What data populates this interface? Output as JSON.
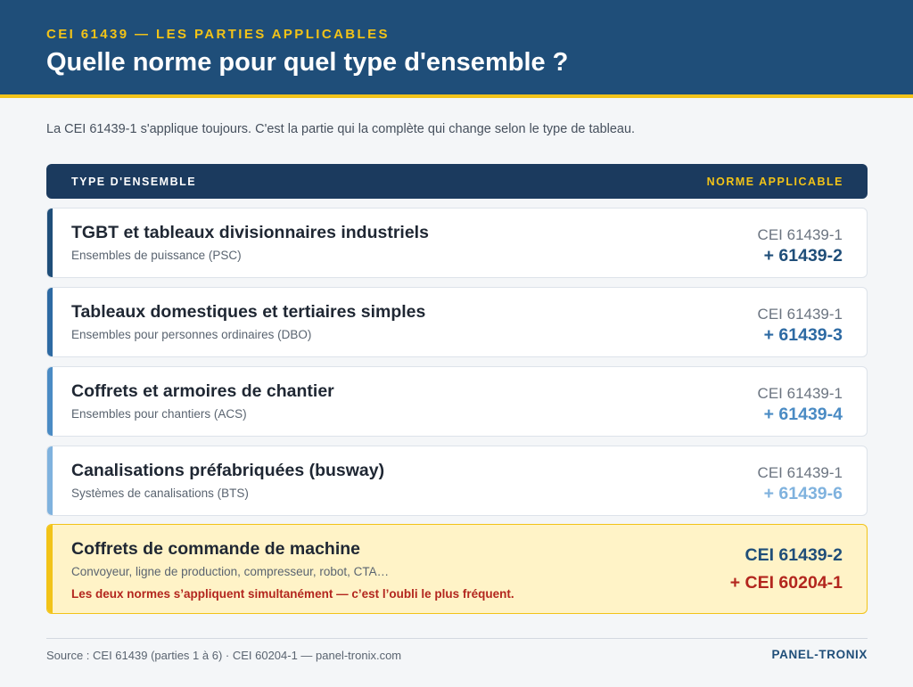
{
  "header": {
    "kicker": "CEI 61439 — LES PARTIES APPLICABLES",
    "title": "Quelle norme pour quel type d'ensemble ?"
  },
  "intro": "La CEI 61439-1 s'applique toujours. C'est la partie qui la complète qui change selon le type de tableau.",
  "table": {
    "col_left": "TYPE D'ENSEMBLE",
    "col_right": "NORME APPLICABLE",
    "rows": [
      {
        "name": "TGBT et tableaux divisionnaires industriels",
        "sub": "Ensembles de puissance (PSC)",
        "base": "CEI 61439-1",
        "plus": "+ 61439-2",
        "accent": "#1f4e79"
      },
      {
        "name": "Tableaux domestiques et tertiaires simples",
        "sub": "Ensembles pour personnes ordinaires (DBO)",
        "base": "CEI 61439-1",
        "plus": "+ 61439-3",
        "accent": "#2d6aa3"
      },
      {
        "name": "Coffrets et armoires de chantier",
        "sub": "Ensembles pour chantiers (ACS)",
        "base": "CEI 61439-1",
        "plus": "+ 61439-4",
        "accent": "#4a8bc4"
      },
      {
        "name": "Canalisations préfabriquées (busway)",
        "sub": "Systèmes de canalisations (BTS)",
        "base": "CEI 61439-1",
        "plus": "+ 61439-6",
        "accent": "#7fb2de"
      }
    ],
    "special": {
      "name": "Coffrets de commande de machine",
      "sub": "Convoyeur, ligne de production, compresseur, robot, CTA…",
      "note": "Les deux normes s’appliquent simultanément — c’est l’oubli le plus fréquent.",
      "base": "CEI 61439-2",
      "plus": "+ CEI 60204-1",
      "accent": "#f2c318"
    }
  },
  "footer": {
    "source": "Source : CEI 61439 (parties 1 à 6) · CEI 60204-1 — panel-tronix.com",
    "brand": "PANEL-TRONIX"
  }
}
